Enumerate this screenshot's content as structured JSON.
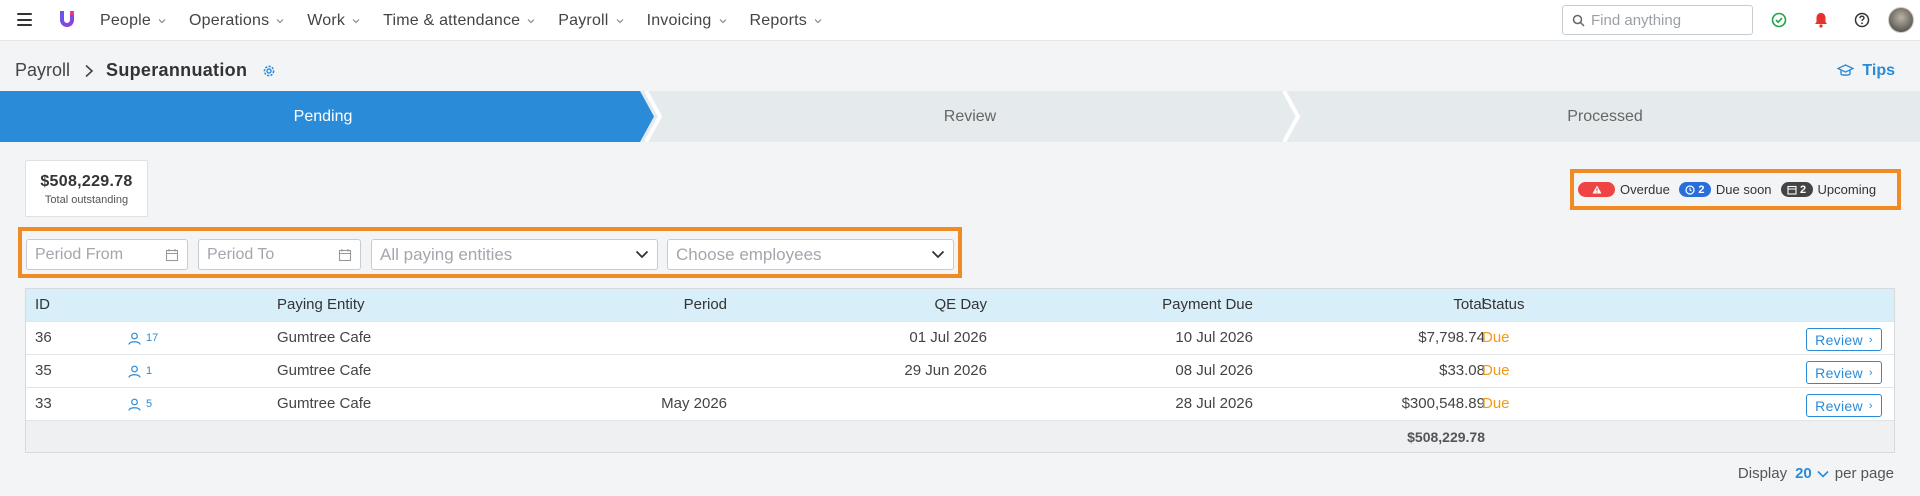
{
  "nav": {
    "items": [
      "People",
      "Operations",
      "Work",
      "Time & attendance",
      "Payroll",
      "Invoicing",
      "Reports"
    ],
    "search_placeholder": "Find anything"
  },
  "breadcrumb": {
    "parent": "Payroll",
    "current": "Superannuation"
  },
  "tips_label": "Tips",
  "steps": [
    "Pending",
    "Review",
    "Processed"
  ],
  "active_step": "Pending",
  "summary": {
    "total": "$508,229.78",
    "total_label": "Total outstanding"
  },
  "legend": {
    "overdue_label": "Overdue",
    "due_soon_count": "2",
    "due_soon_label": "Due soon",
    "upcoming_count": "2",
    "upcoming_label": "Upcoming"
  },
  "filters": {
    "period_from": "Period From",
    "period_to": "Period To",
    "paying_entities": "All paying entities",
    "employees": "Choose employees"
  },
  "table": {
    "headers": {
      "id": "ID",
      "entity": "Paying Entity",
      "period": "Period",
      "qe_day": "QE Day",
      "payment_due": "Payment Due",
      "total": "Total",
      "status": "Status"
    },
    "rows": [
      {
        "id": "36",
        "employees": "17",
        "entity": "Gumtree Cafe",
        "period": "",
        "qe_day": "01 Jul 2026",
        "payment_due": "10 Jul 2026",
        "total": "$7,798.74",
        "status": "Due",
        "action": "Review"
      },
      {
        "id": "35",
        "employees": "1",
        "entity": "Gumtree Cafe",
        "period": "",
        "qe_day": "29 Jun 2026",
        "payment_due": "08 Jul 2026",
        "total": "$33.08",
        "status": "Due",
        "action": "Review"
      },
      {
        "id": "33",
        "employees": "5",
        "entity": "Gumtree Cafe",
        "period": "May 2026",
        "qe_day": "",
        "payment_due": "28 Jul 2026",
        "total": "$300,548.89",
        "status": "Due",
        "action": "Review"
      }
    ],
    "footer_total": "$508,229.78"
  },
  "pager": {
    "prefix": "Display",
    "per_page": "20",
    "suffix": "per page"
  },
  "colors": {
    "accent": "#2a8bd9",
    "highlight": "#f08a24",
    "due": "#f09a1a",
    "overdue": "#ef4444"
  }
}
